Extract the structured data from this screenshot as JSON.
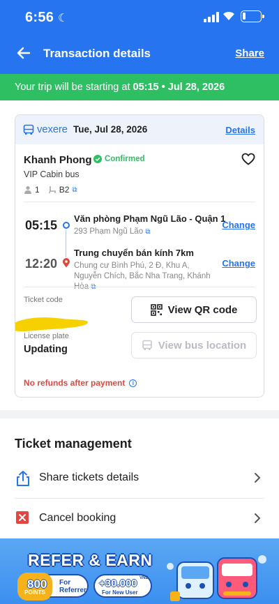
{
  "status_bar": {
    "time": "6:56"
  },
  "header": {
    "title": "Transaction details",
    "share_label": "Share"
  },
  "trip_banner": {
    "prefix": "Your trip will be starting at ",
    "time": "05:15",
    "separator": " • ",
    "date": "Jul 28, 2026"
  },
  "ticket": {
    "brand": "vexere",
    "date": "Tue, Jul 28, 2026",
    "details_label": "Details",
    "operator": "Khanh Phong",
    "status": "Confirmed",
    "bus_type": "VIP Cabin bus",
    "seat_count": "1",
    "seat_code": "B2",
    "departure": {
      "time": "05:15",
      "name": "Văn phòng Phạm Ngũ Lão - Quận 1",
      "address": "293 Phạm Ngũ Lão",
      "change_label": "Change"
    },
    "arrival": {
      "time": "12:20",
      "name": "Trung chuyển bán kính 7km",
      "address": "Chung cư Bình Phú, 2 Đ, Khu A, Nguyễn Chích, Bắc Nha Trang, Khánh Hòa",
      "change_label": "Change"
    },
    "ticket_code_label": "Ticket code",
    "qr_button_label": "View QR code",
    "license_plate_label": "License plate",
    "license_plate_value": "Updating",
    "bus_location_label": "View bus location",
    "refund_warning": "No refunds after payment"
  },
  "management": {
    "title": "Ticket management",
    "items": [
      {
        "label": "Share tickets details",
        "icon": "share-icon"
      },
      {
        "label": "Cancel booking",
        "icon": "cancel-icon"
      }
    ]
  },
  "promo": {
    "title": "REFER & EARN",
    "referrer_amount": "800",
    "referrer_unit": "POINTS",
    "referrer_text": "For Referrer",
    "new_user_amount": "+30.000",
    "new_user_unit": "VND",
    "new_user_text": "For New User"
  },
  "colors": {
    "primary": "#2674f0",
    "success": "#2ebf63",
    "danger": "#e0483f"
  }
}
